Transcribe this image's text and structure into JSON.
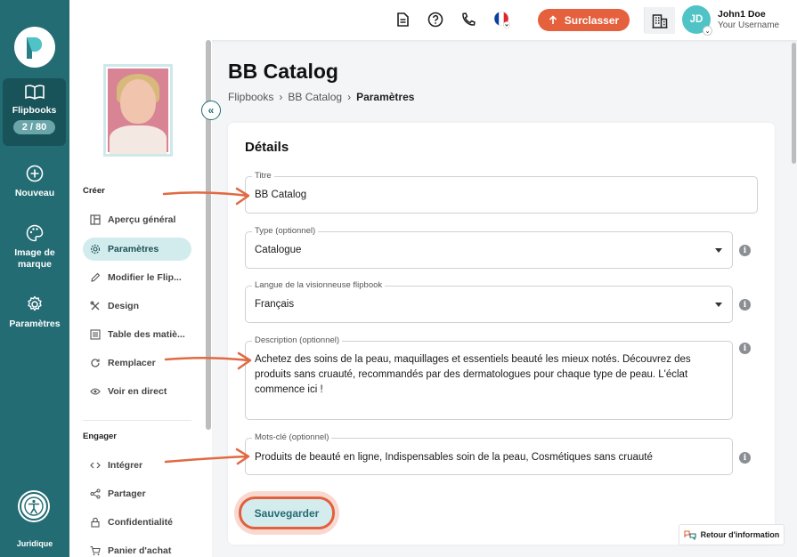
{
  "rail": {
    "items": [
      {
        "label": "Flipbooks",
        "count": "2 / 80"
      },
      {
        "label": "Nouveau"
      },
      {
        "label": "Image de marque"
      },
      {
        "label": "Paramètres"
      }
    ],
    "legal": "Juridique"
  },
  "topbar": {
    "upgrade_label": "Surclasser",
    "avatar_initials": "JD",
    "user_name": "John1 Doe",
    "user_sub": "Your Username"
  },
  "sidebar": {
    "section_create": "Créer",
    "create_items": [
      {
        "label": "Aperçu général",
        "icon": "layout-icon"
      },
      {
        "label": "Paramètres",
        "icon": "gear-icon",
        "active": true
      },
      {
        "label": "Modifier le Flip...",
        "icon": "pencil-icon"
      },
      {
        "label": "Design",
        "icon": "tools-icon"
      },
      {
        "label": "Table des matiè...",
        "icon": "list-icon"
      },
      {
        "label": "Remplacer",
        "icon": "refresh-icon"
      },
      {
        "label": "Voir en direct",
        "icon": "eye-icon"
      }
    ],
    "section_engage": "Engager",
    "engage_items": [
      {
        "label": "Intégrer",
        "icon": "code-icon"
      },
      {
        "label": "Partager",
        "icon": "share-icon"
      },
      {
        "label": "Confidentialité",
        "icon": "lock-icon"
      },
      {
        "label": "Panier d'achat",
        "icon": "cart-icon"
      }
    ]
  },
  "main": {
    "title": "BB Catalog",
    "breadcrumb": [
      "Flipbooks",
      "BB Catalog",
      "Paramètres"
    ],
    "card_title": "Détails",
    "fields": {
      "title": {
        "label": "Titre",
        "value": "BB Catalog"
      },
      "type": {
        "label": "Type (optionnel)",
        "value": "Catalogue"
      },
      "language": {
        "label": "Langue de la visionneuse flipbook",
        "value": "Français"
      },
      "description": {
        "label": "Description (optionnel)",
        "value": "Achetez des soins de la peau, maquillages et essentiels beauté les mieux notés. Découvrez des produits sans cruauté, recommandés par des dermatologues pour chaque type de peau. L'éclat commence ici !"
      },
      "keywords": {
        "label": "Mots-clé (optionnel)",
        "value": "Produits de beauté en ligne, Indispensables soin de la peau, Cosmétiques sans cruauté"
      }
    },
    "save_label": "Sauvegarder",
    "feedback_label": "Retour d'information"
  },
  "colors": {
    "rail": "#236c73",
    "accent": "#e5603c",
    "active_bg": "#d2ecee",
    "avatar": "#4fc3c6"
  }
}
